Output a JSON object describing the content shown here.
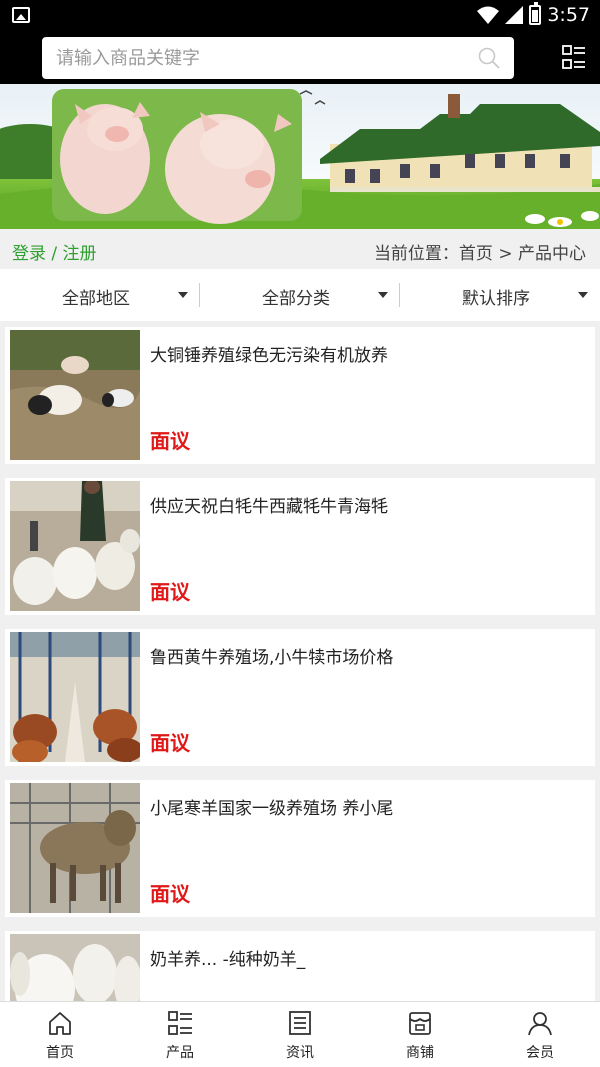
{
  "status_bar": {
    "time": "3:57"
  },
  "search": {
    "placeholder": "请输入商品关键字"
  },
  "location": {
    "login": "登录",
    "separator": " / ",
    "register": "注册",
    "breadcrumb": "当前位置：首页 > 产品中心"
  },
  "filters": [
    {
      "label": "全部地区"
    },
    {
      "label": "全部分类"
    },
    {
      "label": "默认排序"
    }
  ],
  "products": [
    {
      "title": "大铜锤养殖绿色无污染有机放养",
      "price": "面议"
    },
    {
      "title": "供应天祝白牦牛西藏牦牛青海牦",
      "price": "面议"
    },
    {
      "title": "鲁西黄牛养殖场,小牛犊市场价格",
      "price": "面议"
    },
    {
      "title": "小尾寒羊国家一级养殖场 养小尾",
      "price": "面议"
    },
    {
      "title": "奶羊养... -纯种奶羊_",
      "price": ""
    }
  ],
  "bottom_nav": [
    {
      "label": "首页",
      "icon": "home-icon"
    },
    {
      "label": "产品",
      "icon": "list-icon"
    },
    {
      "label": "资讯",
      "icon": "news-icon"
    },
    {
      "label": "商铺",
      "icon": "shop-icon"
    },
    {
      "label": "会员",
      "icon": "user-icon"
    }
  ],
  "colors": {
    "accent_green": "#2ea02e",
    "price_red": "#e01818",
    "header_bg": "#000000"
  }
}
